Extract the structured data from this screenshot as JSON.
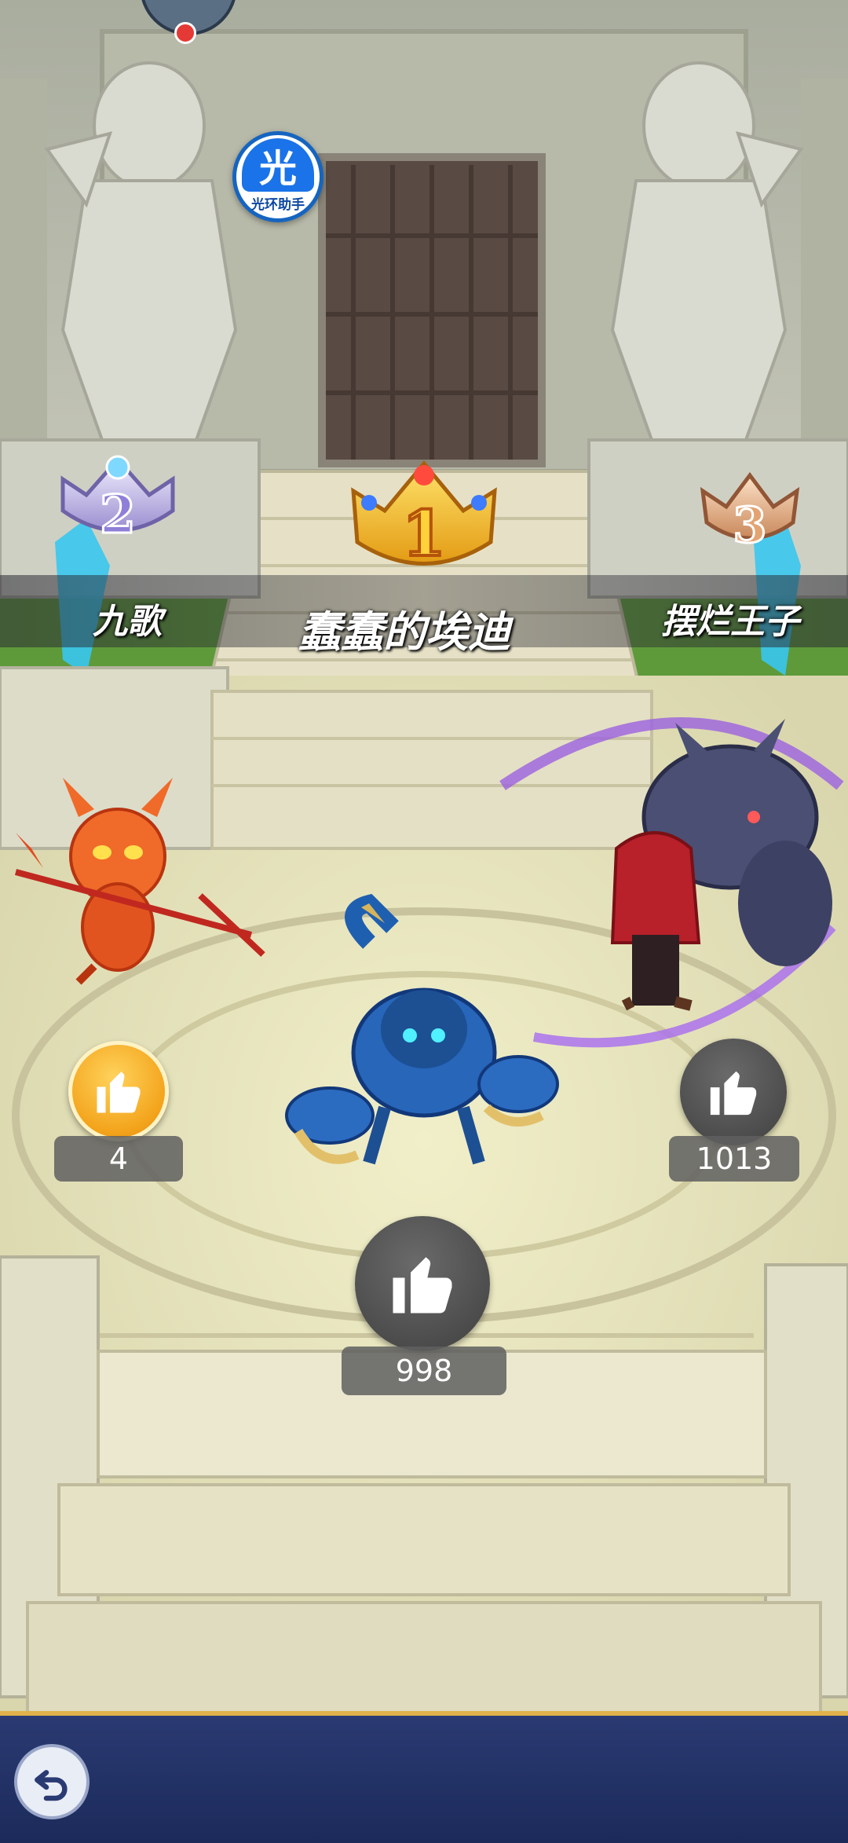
{
  "helper": {
    "glyph": "光",
    "label": "光环助手"
  },
  "podium": [
    {
      "rank": "1",
      "name": "蠢蠢的埃迪",
      "likes": "998",
      "like_state": "inactive"
    },
    {
      "rank": "2",
      "name": "九歌",
      "likes": "4",
      "like_state": "active"
    },
    {
      "rank": "3",
      "name": "摆烂王子",
      "likes": "1013",
      "like_state": "inactive"
    }
  ],
  "icons": {
    "back": "back-arrow-icon",
    "like": "thumbs-up-icon",
    "crown_1": "gold-crown-icon",
    "crown_2": "silver-crown-icon",
    "crown_3": "bronze-crown-icon"
  },
  "colors": {
    "like_active": "#f3a31b",
    "like_inactive": "#4f4f4f",
    "crown_gold": "#f4c430",
    "crown_silver": "#b9a7e8",
    "crown_bronze": "#e8b08a",
    "bottom_bar": "#233265",
    "bar_trim": "#e0b24a"
  }
}
